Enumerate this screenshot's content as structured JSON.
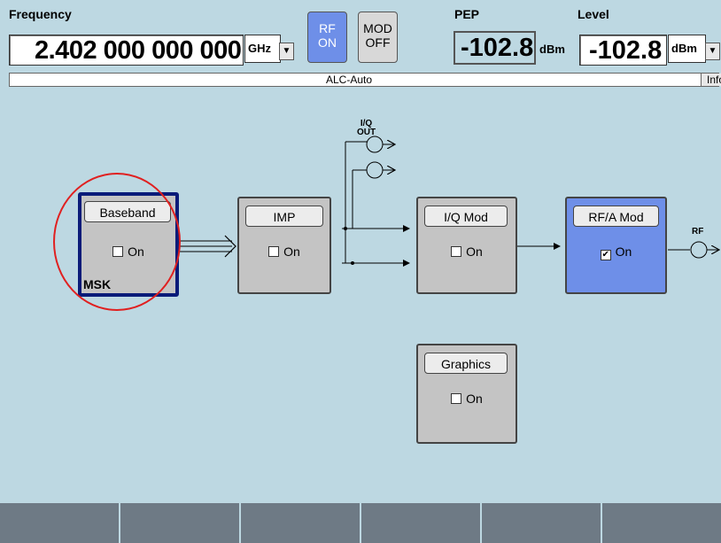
{
  "header": {
    "frequency_label": "Frequency",
    "frequency_value": "2.402 000 000 000",
    "frequency_unit": "GHz",
    "rf_button": {
      "line1": "RF",
      "line2": "ON"
    },
    "mod_button": {
      "line1": "MOD",
      "line2": "OFF"
    },
    "pep_label": "PEP",
    "pep_value": "-102.8",
    "pep_unit": "dBm",
    "level_label": "Level",
    "level_value": "-102.8",
    "level_unit": "dBm"
  },
  "status_bar": {
    "text": "ALC-Auto",
    "info_tab": "Info"
  },
  "diagram": {
    "iq_out_label_line1": "I/Q",
    "iq_out_label_line2": "OUT",
    "rf_out_label": "RF",
    "blocks": [
      {
        "label": "Baseband",
        "checkbox": "On",
        "checked": false,
        "footer": "MSK"
      },
      {
        "label": "IMP",
        "checkbox": "On",
        "checked": false
      },
      {
        "label": "I/Q Mod",
        "checkbox": "On",
        "checked": false
      },
      {
        "label": "RF/A Mod",
        "checkbox": "On",
        "checked": true
      },
      {
        "label": "Graphics",
        "checkbox": "On",
        "checked": false
      }
    ]
  },
  "colors": {
    "background": "#bdd8e2",
    "active_blue": "#6e8fe8",
    "selection_border": "#0a1b79",
    "annotation_circle": "#e02020",
    "softkey": "#6e7a85"
  }
}
